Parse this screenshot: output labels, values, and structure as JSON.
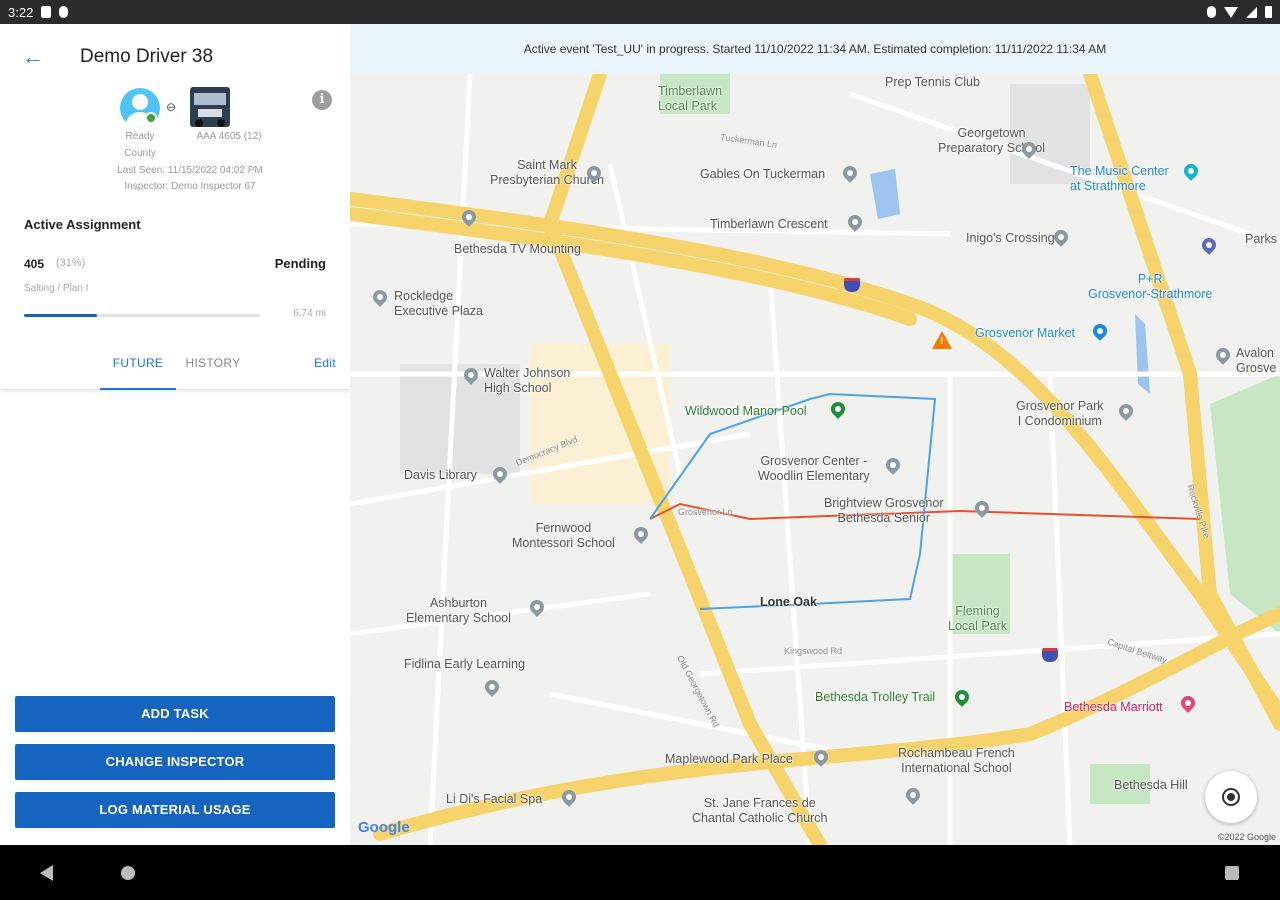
{
  "status_bar": {
    "time": "3:22"
  },
  "driver": {
    "title": "Demo Driver 38",
    "status_line1": "Ready",
    "status_line2": "County",
    "vehicle_label": "AAA 4605 (12)",
    "last_seen": "Last Seen: 11/15/2022 04:02 PM",
    "inspector": "Inspector: Demo Inspector 67",
    "status_color": "#43a047"
  },
  "assignment": {
    "section_title": "Active Assignment",
    "id": "405",
    "percent_text": "(31%)",
    "progress_fraction": 0.31,
    "status": "Pending",
    "subtitle": "Salting / Plan I",
    "distance": "6.74 mi"
  },
  "tabs": {
    "future": "FUTURE",
    "history": "HISTORY",
    "edit": "Edit"
  },
  "buttons": {
    "add_task": "ADD TASK",
    "change_inspector": "CHANGE INSPECTOR",
    "log_material": "LOG MATERIAL USAGE"
  },
  "map": {
    "banner": "Active event 'Test_UU' in progress. Started 11/10/2022 11:34 AM. Estimated completion: 11/11/2022 11:34 AM",
    "google_logo": "Google",
    "copyright": "©2022 Google",
    "pois": {
      "prep_tennis": "Prep Tennis Club",
      "timberlawn_park": "Timberlawn\nLocal Park",
      "georgetown_prep": "Georgetown\nPreparatory School",
      "music_center": "The Music Center\nat Strathmore",
      "saint_mark": "Saint Mark\nPresbyterian Church",
      "gables": "Gables On Tuckerman",
      "timberlawn_crescent": "Timberlawn Crescent",
      "inigos": "Inigo's Crossing",
      "bethesda_tv": "Bethesda TV Mounting",
      "pr_station": "P+R\nGrosvenor-Strathmore",
      "parks": "Parks",
      "rockledge": "Rockledge\nExecutive Plaza",
      "grosvenor_market": "Grosvenor Market",
      "avalon": "Avalon\nGrosve",
      "walter_johnson": "Walter Johnson\nHigh School",
      "wildwood_pool": "Wildwood Manor Pool",
      "grosvenor_park": "Grosvenor Park\nI Condominium",
      "davis_library": "Davis Library",
      "grosvenor_center": "Grosvenor Center -\nWoodlin Elementary",
      "brightview": "Brightview Grosvenor\nBethesda Senior",
      "fernwood": "Fernwood\nMontessori School",
      "ashburton": "Ashburton\nElementary School",
      "lone_oak": "Lone Oak",
      "fleming_park": "Fleming\nLocal Park",
      "fidlina": "Fidlina Early Learning",
      "bethesda_trolley": "Bethesda Trolley Trail",
      "bethesda_marriott": "Bethesda Marriott",
      "maplewood": "Maplewood Park Place",
      "rochambeau": "Rochambeau French\nInternational School",
      "bethesda_hill": "Bethesda Hill",
      "li_dis": "Li Di's Facial Spa",
      "st_jane": "St. Jane Frances de\nChantal Catholic Church"
    },
    "roads": {
      "grosvenor_ln": "Grosvenor Ln",
      "democracy_blvd": "Democracy Blvd",
      "old_georgetown": "Old Georgetown Rd",
      "capital_beltway": "Capital Beltway",
      "rockville_pike": "Rockville Pike",
      "kingswood": "Kingswood Rd",
      "tuckerman": "Tuckerman Ln"
    },
    "colors": {
      "highway": "#f7d36b",
      "route_red": "#e8502f",
      "route_blue": "#4da3e8",
      "park": "#c7e6c4",
      "water": "#9cc4ef"
    }
  }
}
